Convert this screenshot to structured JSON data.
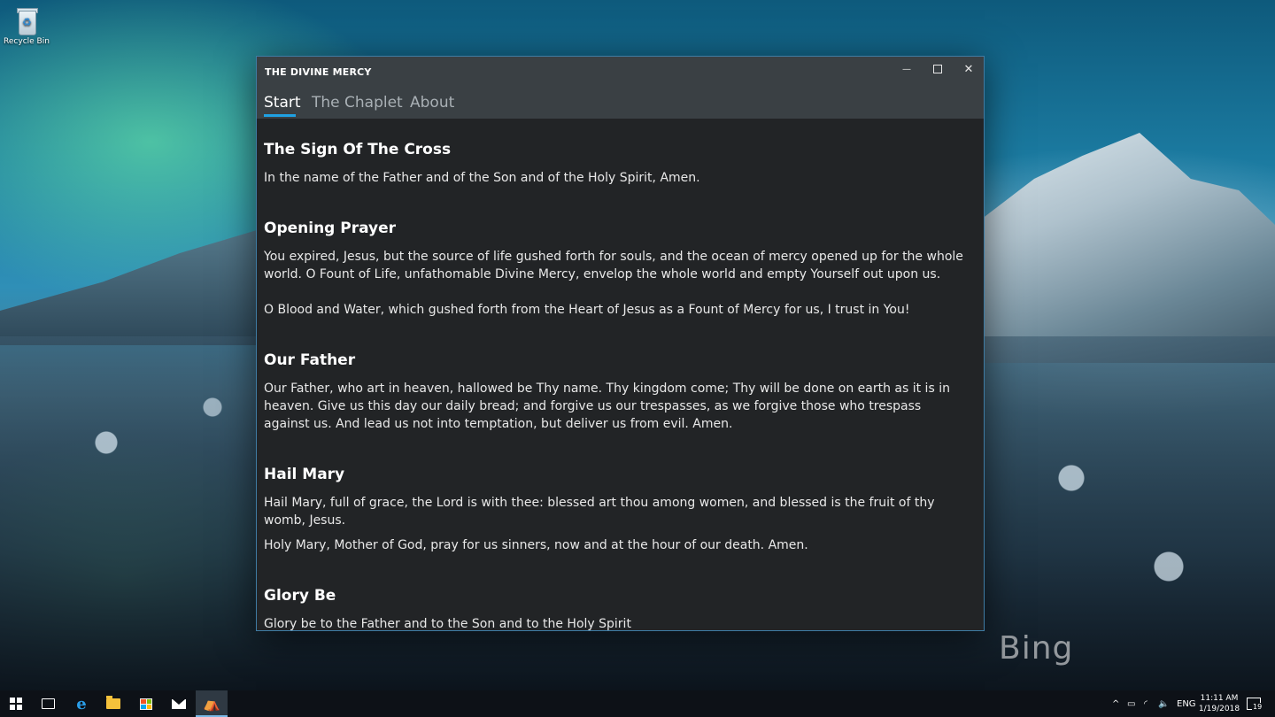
{
  "desktop": {
    "icons": [
      {
        "label": "Recycle Bin"
      }
    ]
  },
  "window": {
    "title": "THE DIVINE MERCY",
    "controls": {
      "minimize": "—",
      "close": "✕"
    },
    "tabs": [
      {
        "label": "Start",
        "active": true
      },
      {
        "label": "The Chaplet",
        "active": false
      },
      {
        "label": "About",
        "active": false
      }
    ],
    "sections": [
      {
        "heading": "The Sign Of The Cross",
        "paragraphs": [
          "In the name of the Father and of the Son and of the Holy Spirit, Amen."
        ]
      },
      {
        "heading": "Opening Prayer",
        "paragraphs": [
          "You expired, Jesus, but the source of life gushed forth for souls, and the ocean of mercy opened up for the whole world. O Fount of Life, unfathomable Divine Mercy, envelop the whole world and empty Yourself out upon us.",
          "O Blood and Water, which gushed forth from the Heart of Jesus as a Fount of Mercy for us, I trust in You!"
        ]
      },
      {
        "heading": "Our Father",
        "paragraphs": [
          "Our Father, who art in heaven, hallowed be Thy name. Thy kingdom come; Thy will be done on earth as it is in heaven. Give us this day our daily bread; and forgive us our trespasses, as we forgive those who trespass against us. And lead us not into temptation, but deliver us from evil. Amen."
        ]
      },
      {
        "heading": "Hail Mary",
        "paragraphs": [
          "Hail Mary, full of grace, the Lord is with thee: blessed art thou among women, and blessed is the fruit of thy womb, Jesus.",
          "Holy Mary, Mother of God, pray for us sinners, now and at the hour of our death. Amen."
        ]
      },
      {
        "heading": "Glory Be",
        "paragraphs": [
          "Glory be to the Father and to the Son and to the Holy Spirit"
        ]
      }
    ]
  },
  "taskbar": {
    "icons": [
      "windows-start-icon",
      "task-view-icon",
      "edge-icon",
      "file-explorer-icon",
      "store-icon",
      "mail-icon",
      "divine-mercy-app-icon"
    ],
    "tray": {
      "chevron": "^",
      "language": "ENG",
      "time": "11:11 AM",
      "date": "1/19/2018",
      "notification_count": "19"
    }
  },
  "watermark": {
    "text": "Bing"
  }
}
